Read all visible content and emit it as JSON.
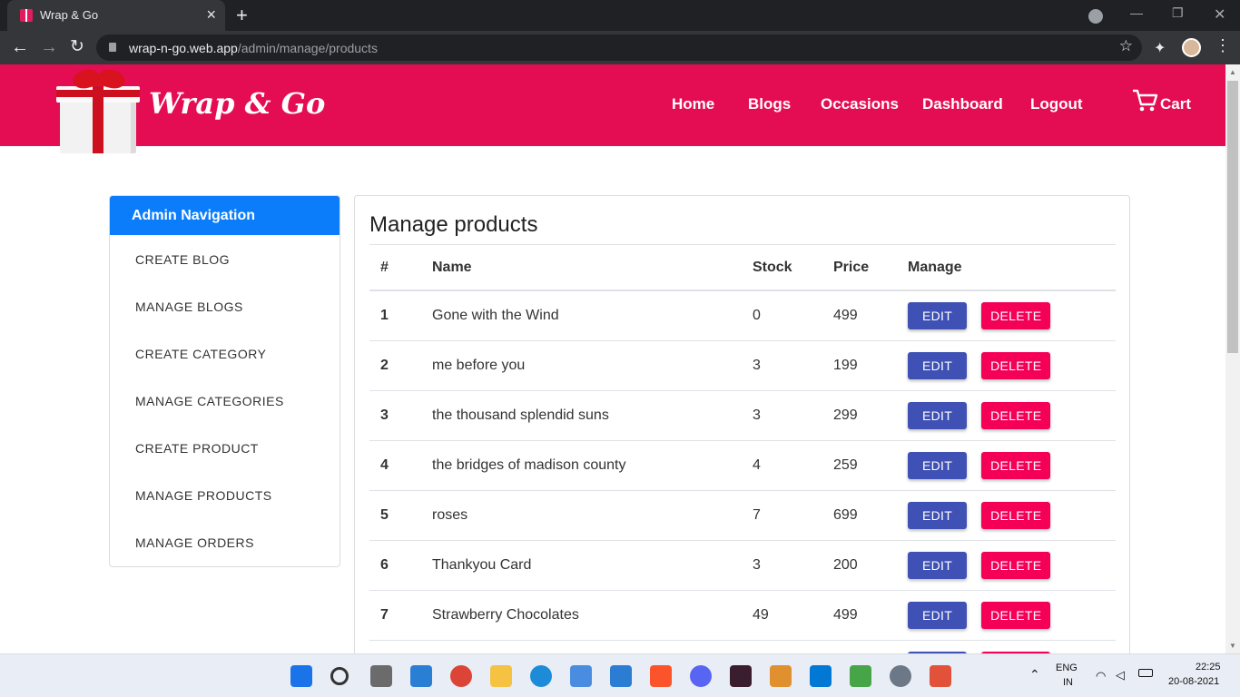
{
  "browser": {
    "tab_title": "Wrap & Go",
    "url_host": "wrap-n-go.web.app",
    "url_path": "/admin/manage/products"
  },
  "header": {
    "brand": "Wrap & Go",
    "nav": [
      "Home",
      "Blogs",
      "Occasions",
      "Dashboard",
      "Logout"
    ],
    "cart_label": "Cart",
    "bg_color": "#e40d54"
  },
  "sidebar": {
    "title": "Admin Navigation",
    "items": [
      "CREATE BLOG",
      "MANAGE BLOGS",
      "CREATE CATEGORY",
      "MANAGE CATEGORIES",
      "CREATE PRODUCT",
      "MANAGE PRODUCTS",
      "MANAGE ORDERS"
    ]
  },
  "main": {
    "title": "Manage products",
    "columns": [
      "#",
      "Name",
      "Stock",
      "Price",
      "Manage"
    ],
    "edit_label": "EDIT",
    "delete_label": "DELETE",
    "rows": [
      {
        "num": "1",
        "name": "Gone with the Wind",
        "stock": "0",
        "price": "499"
      },
      {
        "num": "2",
        "name": "me before you",
        "stock": "3",
        "price": "199"
      },
      {
        "num": "3",
        "name": "the thousand splendid suns",
        "stock": "3",
        "price": "299"
      },
      {
        "num": "4",
        "name": "the bridges of madison county",
        "stock": "4",
        "price": "259"
      },
      {
        "num": "5",
        "name": "roses",
        "stock": "7",
        "price": "699"
      },
      {
        "num": "6",
        "name": "Thankyou Card",
        "stock": "3",
        "price": "200"
      },
      {
        "num": "7",
        "name": "Strawberry Chocolates",
        "stock": "49",
        "price": "499"
      },
      {
        "num": "",
        "name": "",
        "stock": "",
        "price": ""
      }
    ]
  },
  "taskbar": {
    "lang_line1": "ENG",
    "lang_line2": "IN",
    "time": "22:25",
    "date": "20-08-2021"
  }
}
